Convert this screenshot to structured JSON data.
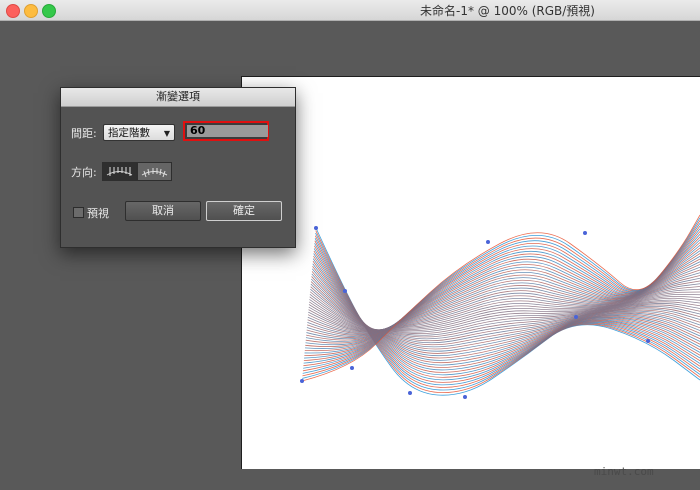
{
  "window": {
    "title": "未命名-1* @ 100% (RGB/預視)"
  },
  "dialog": {
    "title": "漸變選項",
    "spacing_label": "間距:",
    "spacing_mode": "指定階數",
    "steps_value": "60",
    "orientation_label": "方向:",
    "orientation_options": [
      "align-to-page-icon",
      "align-to-path-icon"
    ],
    "preview_label": "預視",
    "preview_checked": false,
    "cancel_label": "取消",
    "ok_label": "確定"
  },
  "colors": {
    "blend_start": "#e8502e",
    "blend_end": "#1a8fd6",
    "highlight": "#e01010"
  },
  "watermark": "minwt.com"
}
